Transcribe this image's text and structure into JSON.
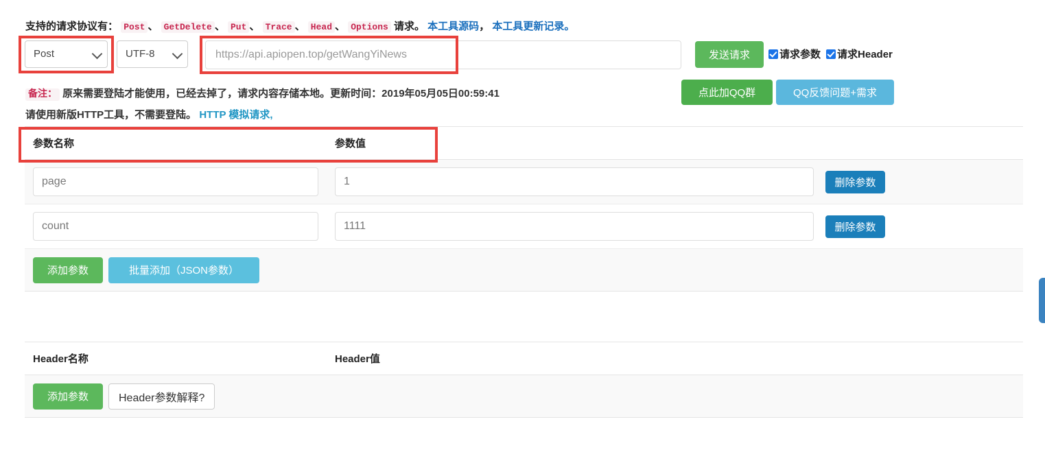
{
  "protocol_line": {
    "lead": "支持的请求协议有：",
    "methods": [
      "Post",
      "GetDelete",
      "Put",
      "Trace",
      "Head",
      "Options"
    ],
    "separator": "、",
    "tail": "请求。",
    "links": [
      {
        "label": "本工具源码",
        "color": "#1a6fbd"
      },
      {
        "label": "本工具更新记录。",
        "color": "#1a6fbd"
      }
    ],
    "link_separator": "，"
  },
  "toolbar": {
    "method_select": {
      "value": "Post",
      "icon": "chevron-down-icon"
    },
    "charset_select": {
      "value": "UTF-8",
      "icon": "chevron-down-icon"
    },
    "url_input": {
      "value": "https://api.apiopen.top/getWangYiNews",
      "placeholder": "https://api.apiopen.top/getWangYiNews"
    },
    "send_button": {
      "label": "发送请求",
      "color": "#5cb85c"
    },
    "checkboxes": [
      {
        "label": "请求参数",
        "checked": true
      },
      {
        "label": "请求Header",
        "checked": true
      }
    ]
  },
  "note": {
    "tag": "备注：",
    "line1": "原来需要登陆才能使用，已经去掉了，请求内容存储本地。更新时间：2019年05月05日00:59:41",
    "line2_prefix": "请使用新版HTTP工具，不需要登陆。",
    "line2_link": "HTTP 模拟请求,",
    "update_time": "2019年05月05日00:59:41"
  },
  "qq_buttons": [
    {
      "label": "点此加QQ群",
      "color": "#4cae4c"
    },
    {
      "label": "QQ反馈问题+需求",
      "color": "#5bb7dd"
    }
  ],
  "params_table": {
    "columns": [
      "参数名称",
      "参数值",
      ""
    ],
    "rows": [
      {
        "name": "page",
        "value": "1",
        "delete_label": "删除参数"
      },
      {
        "name": "count",
        "value": "1111",
        "delete_label": "删除参数"
      }
    ],
    "footer": {
      "add_label": "添加参数",
      "bulk_label": "批量添加（JSON参数）"
    }
  },
  "headers_table": {
    "columns": [
      "Header名称",
      "Header值",
      ""
    ],
    "rows": [],
    "footer": {
      "add_label": "添加参数",
      "help_label": "Header参数解释?"
    }
  },
  "colors": {
    "annotation_red": "#e8413c",
    "green": "#5cb85c",
    "blue": "#1b7fba",
    "sky": "#5bc0de",
    "code_pink": "#c7254e",
    "link_blue": "#1a6fbd",
    "link_cyan": "#2196c4",
    "edge_tab_blue": "#3b83c0"
  },
  "edge_tab": {
    "name": "side-panel-handle"
  }
}
